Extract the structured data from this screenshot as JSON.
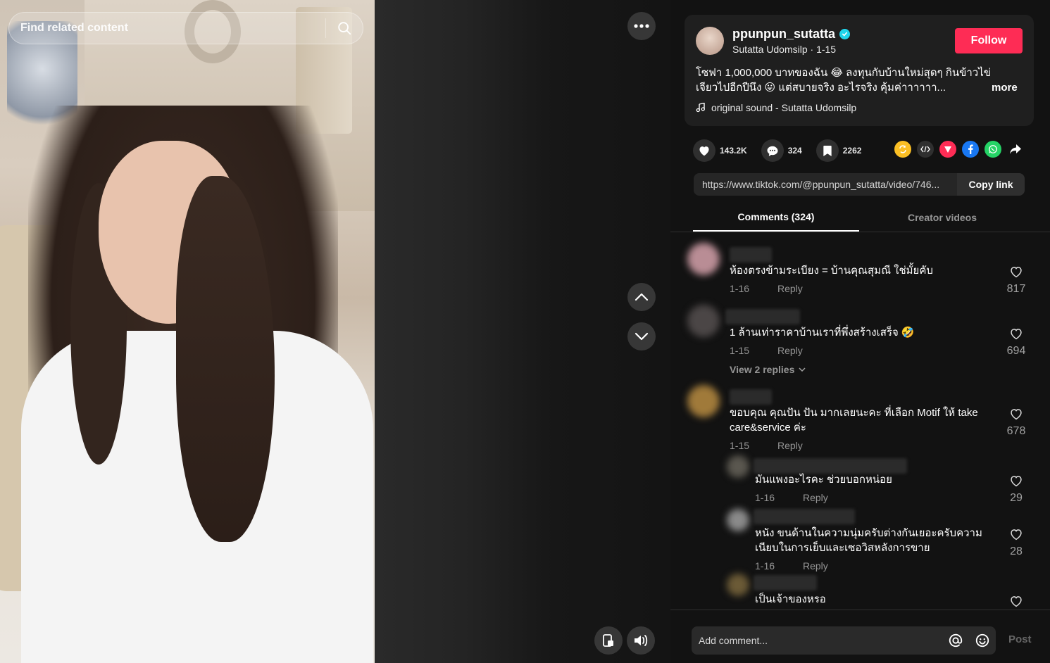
{
  "search": {
    "placeholder": "Find related content"
  },
  "author": {
    "username": "ppunpun_sutatta",
    "display_name": "Sutatta Udomsilp",
    "date": "1-15",
    "follow_label": "Follow"
  },
  "description": {
    "text": "โซฟา 1,000,000 บาทของฉัน 😂 ลงทุนกับบ้านใหม่สุดๆ กินข้าวไข่เจียวไปอีกปีนึง 😛 แต่สบายจริง อะไรจริง คุ้มค่าาาาาา...",
    "more_label": "more",
    "sound": "original sound - Sutatta Udomsilp"
  },
  "stats": {
    "likes": "143.2K",
    "comments": "324",
    "saves": "2262"
  },
  "share_icons": [
    "repost-icon",
    "embed-icon",
    "send-icon",
    "facebook-icon",
    "whatsapp-icon",
    "share-arrow-icon"
  ],
  "link": {
    "url": "https://www.tiktok.com/@ppunpun_sutatta/video/746...",
    "copy_label": "Copy link"
  },
  "tabs": {
    "comments": "Comments (324)",
    "creator": "Creator videos"
  },
  "comments": [
    {
      "text": "ห้องตรงข้ามระเบียง = บ้านคุณสุมณี ใช่มั้ยคับ",
      "date": "1-16",
      "reply": "Reply",
      "likes": "817"
    },
    {
      "text": "1 ล้านเท่าราคาบ้านเราที่พึ่งสร้างเสร็จ 🤣",
      "date": "1-15",
      "reply": "Reply",
      "likes": "694",
      "view_replies": "View 2 replies"
    },
    {
      "text": "ขอบคุณ คุณปัน ปัน มากเลยนะคะ ที่เลือก Motif ให้ take care&service ค่ะ",
      "date": "1-15",
      "reply": "Reply",
      "likes": "678"
    },
    {
      "text": "มันแพงอะไรคะ ช่วยบอกหน่อย",
      "date": "1-16",
      "reply": "Reply",
      "likes": "29"
    },
    {
      "text": "หนัง ขนด้านในความนุ่มครับต่างกันเยอะครับความเนียบในการเย็บและเซอวิสหลังการขาย",
      "date": "1-16",
      "reply": "Reply",
      "likes": "28"
    },
    {
      "text": "เป็นเจ้าของหรอ"
    }
  ],
  "composer": {
    "placeholder": "Add comment...",
    "post_label": "Post"
  },
  "colors": {
    "accent": "#fe2c55",
    "verified": "#20d5ec",
    "background": "#121212"
  }
}
